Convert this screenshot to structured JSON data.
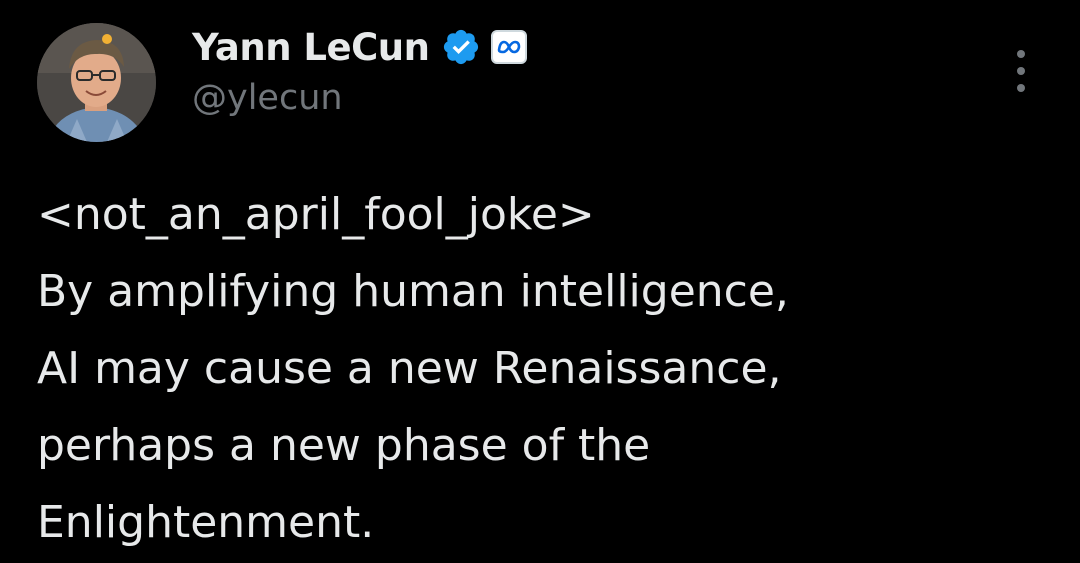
{
  "author": {
    "display_name": "Yann LeCun",
    "handle": "@ylecun",
    "avatar": "profile-photo",
    "verified_icon": "verified-badge-icon",
    "affiliation_icon": "meta-logo-icon"
  },
  "tweet": {
    "lines": [
      "<not_an_april_fool_joke>",
      "By amplifying human intelligence,",
      "AI may cause a new Renaissance,",
      "perhaps a new phase of the",
      "Enlightenment."
    ]
  },
  "menu": {
    "icon": "more-options-icon"
  },
  "colors": {
    "background": "#000000",
    "primary_text": "#e7e9ea",
    "secondary_text": "#71767b",
    "verified_blue": "#1d9bf0"
  }
}
